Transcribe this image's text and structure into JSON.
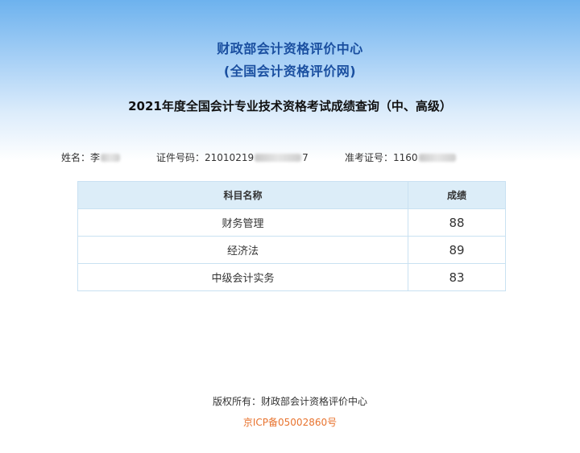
{
  "header": {
    "org_name": "财政部会计资格评价中心",
    "org_subtitle": "(全国会计资格评价网)",
    "exam_title": "2021年度全国会计专业技术资格考试成绩查询（中、高级）"
  },
  "candidate": {
    "name_label": "姓名：",
    "name_value": "李",
    "id_label": "证件号码：",
    "id_prefix": "21010219",
    "id_suffix": "7",
    "ticket_label": "准考证号：",
    "ticket_prefix": "1160"
  },
  "score_table": {
    "headers": [
      "科目名称",
      "成绩"
    ],
    "rows": [
      {
        "subject": "财务管理",
        "score": "88"
      },
      {
        "subject": "经济法",
        "score": "89"
      },
      {
        "subject": "中级会计实务",
        "score": "83"
      }
    ]
  },
  "footer": {
    "copyright": "版权所有：财政部会计资格评价中心",
    "icp": "京ICP备05002860号"
  },
  "colors": {
    "title_blue": "#1a4fa0",
    "table_header_bg": "#dcedf8",
    "table_border": "#c9e1f2",
    "icp_orange": "#e8732e"
  }
}
